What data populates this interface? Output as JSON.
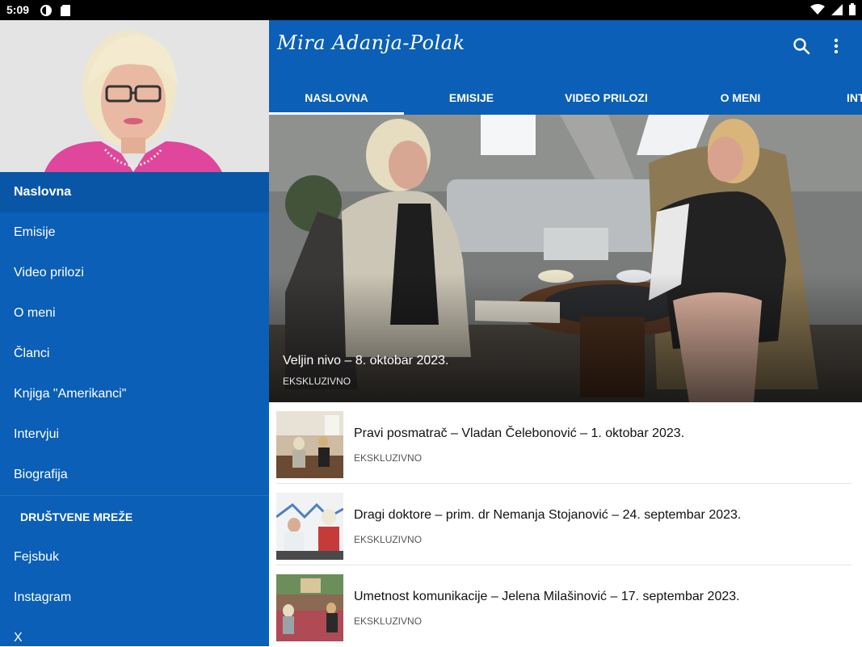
{
  "status_bar": {
    "time": "5:09",
    "icons": [
      "dnd-icon",
      "sd-card-icon",
      "wifi-icon",
      "signal-icon",
      "battery-icon"
    ]
  },
  "app": {
    "logo_text": "Mira Adanja-Polak",
    "accent_color": "#0b5fb6"
  },
  "drawer": {
    "items": [
      {
        "label": "Naslovna",
        "active": true
      },
      {
        "label": "Emisije"
      },
      {
        "label": "Video prilozi"
      },
      {
        "label": "O meni"
      },
      {
        "label": "Članci"
      },
      {
        "label": "Knjiga \"Amerikanci\""
      },
      {
        "label": "Intervjui"
      },
      {
        "label": "Biografija"
      }
    ],
    "section_title": "DRUŠTVENE MREŽE",
    "social": [
      {
        "label": "Fejsbuk"
      },
      {
        "label": "Instagram"
      },
      {
        "label": "X"
      }
    ]
  },
  "tabs": [
    {
      "label": "NASLOVNA",
      "active": true
    },
    {
      "label": "EMISIJE"
    },
    {
      "label": "VIDEO PRILOZI"
    },
    {
      "label": "O MENI"
    },
    {
      "label": "INT"
    }
  ],
  "hero": {
    "title": "Veljin nivo – 8. oktobar 2023.",
    "category": "EKSKLUZIVNO"
  },
  "articles": [
    {
      "title": "Pravi posmatrač – Vladan Čelebonović – 1. oktobar 2023.",
      "category": "EKSKLUZIVNO"
    },
    {
      "title": "Dragi doktore – prim. dr Nemanja Stojanović – 24. septembar 2023.",
      "category": "EKSKLUZIVNO"
    },
    {
      "title": "Umetnost komunikacije – Jelena Milašinović – 17. septembar 2023.",
      "category": "EKSKLUZIVNO"
    }
  ]
}
